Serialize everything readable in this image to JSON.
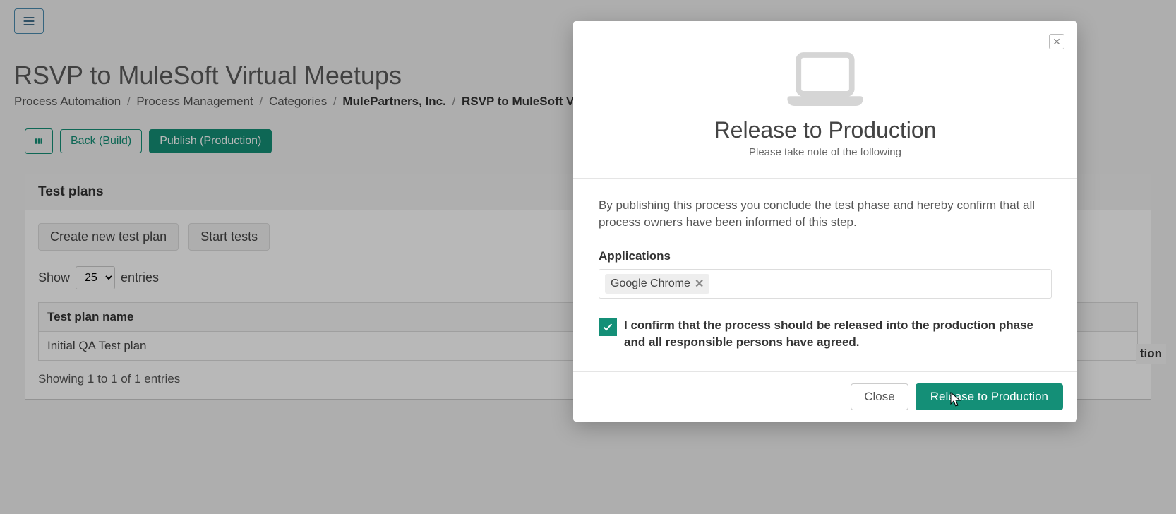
{
  "page": {
    "title": "RSVP to MuleSoft Virtual Meetups"
  },
  "breadcrumb": {
    "c0": "Process Automation",
    "c1": "Process Management",
    "c2": "Categories",
    "c3": "MulePartners, Inc.",
    "c4": "RSVP to MuleSoft Virtual M"
  },
  "actions": {
    "back": "Back (Build)",
    "publish": "Publish (Production)"
  },
  "panel": {
    "heading": "Test plans",
    "create": "Create new test plan",
    "start": "Start tests",
    "show": "Show",
    "entries": "entries",
    "page_size": "25",
    "col_name": "Test plan name",
    "rows": {
      "0": {
        "name": "Initial QA Test plan"
      }
    },
    "footer": "Showing 1 to 1 of 1 entries"
  },
  "right_fragment": "tion",
  "modal": {
    "title": "Release to Production",
    "subtitle": "Please take note of the following",
    "lead": "By publishing this process you conclude the test phase and hereby confirm that all process owners have been informed of this step.",
    "apps_label": "Applications",
    "apps": {
      "0": "Google Chrome"
    },
    "confirm": "I confirm that the process should be released into the production phase and all responsible persons have agreed.",
    "close": "Close",
    "release": "Release to Production"
  }
}
